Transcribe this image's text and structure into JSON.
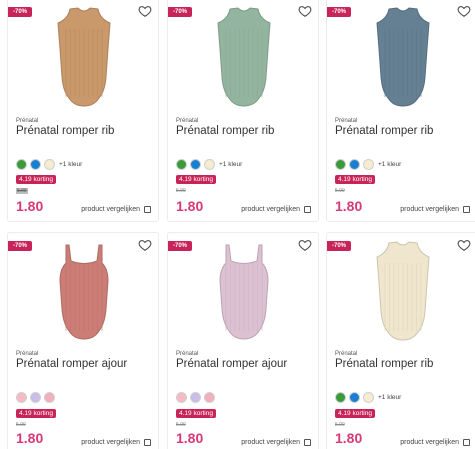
{
  "products": [
    {
      "badge": "-70%",
      "brand": "Prénatal",
      "title": "Prénatal romper rib",
      "style": "sleeveless",
      "color": "#c9986b",
      "swatches": [
        "#3a9a3c",
        "#1a7fd0",
        "#f6ecd2"
      ],
      "more_colors": "+1 kleur",
      "korting": "4.19 korting",
      "old_price": "5.99",
      "old_boxed": true,
      "price": "1.80",
      "compare": "product vergelijken"
    },
    {
      "badge": "-70%",
      "brand": "Prénatal",
      "title": "Prénatal romper rib",
      "style": "sleeveless",
      "color": "#93b59f",
      "swatches": [
        "#3a9a3c",
        "#1a7fd0",
        "#f6ecd2"
      ],
      "more_colors": "+1 kleur",
      "korting": "4.19 korting",
      "old_price": "5.99",
      "old_boxed": false,
      "price": "1.80",
      "compare": "product vergelijken"
    },
    {
      "badge": "-70%",
      "brand": "Prénatal",
      "title": "Prénatal romper rib",
      "style": "sleeveless",
      "color": "#657f93",
      "swatches": [
        "#3a9a3c",
        "#1a7fd0",
        "#f6ecd2"
      ],
      "more_colors": "+1 kleur",
      "korting": "4.19 korting",
      "old_price": "5.99",
      "old_boxed": false,
      "price": "1.80",
      "compare": "product vergelijken"
    },
    {
      "badge": "-70%",
      "brand": "Prénatal",
      "title": "Prénatal romper ajour",
      "style": "strap",
      "color": "#cc7d75",
      "swatches": [
        "#f5b9c6",
        "#c9bde9",
        "#f3aebb"
      ],
      "more_colors": "",
      "korting": "4.19 korting",
      "old_price": "5.99",
      "old_boxed": false,
      "price": "1.80",
      "compare": "product vergelijken"
    },
    {
      "badge": "-70%",
      "brand": "Prénatal",
      "title": "Prénatal romper ajour",
      "style": "strap",
      "color": "#dcc1d3",
      "swatches": [
        "#f5b9c6",
        "#c9bde9",
        "#f3aebb"
      ],
      "more_colors": "",
      "korting": "4.19 korting",
      "old_price": "5.99",
      "old_boxed": false,
      "price": "1.80",
      "compare": "product vergelijken"
    },
    {
      "badge": "-70%",
      "brand": "Prénatal",
      "title": "Prénatal romper rib",
      "style": "sleeveless",
      "color": "#efe6cd",
      "swatches": [
        "#3a9a3c",
        "#1a7fd0",
        "#f6ecd2"
      ],
      "more_colors": "+1 kleur",
      "korting": "4.19 korting",
      "old_price": "5.99",
      "old_boxed": false,
      "price": "1.80",
      "compare": "product vergelijken"
    }
  ]
}
